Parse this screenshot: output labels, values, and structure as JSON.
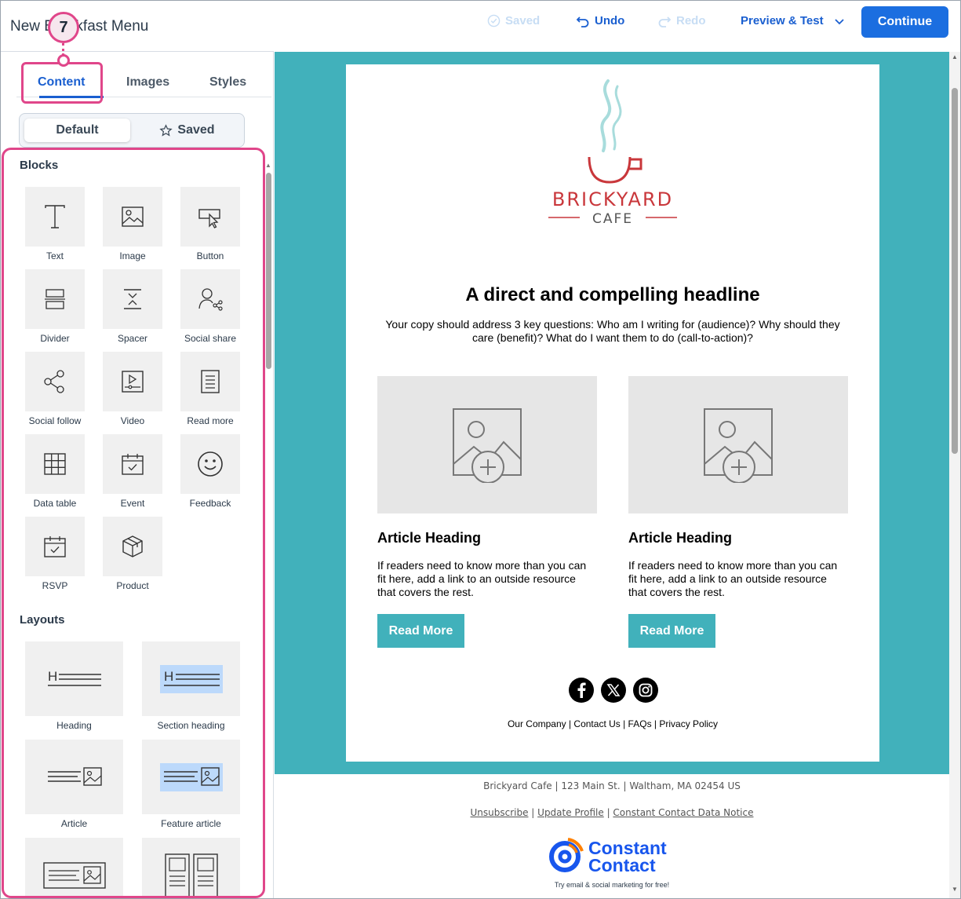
{
  "header": {
    "title": "New Breakfast Menu",
    "saved_label": "Saved",
    "undo_label": "Undo",
    "redo_label": "Redo",
    "preview_label": "Preview & Test",
    "continue_label": "Continue"
  },
  "callout": {
    "number": "7"
  },
  "tabs": [
    {
      "label": "Content"
    },
    {
      "label": "Images"
    },
    {
      "label": "Styles"
    }
  ],
  "segmented": {
    "default_label": "Default",
    "saved_label": "Saved"
  },
  "blocks": {
    "title": "Blocks",
    "items": [
      {
        "label": "Text",
        "icon": "text-icon"
      },
      {
        "label": "Image",
        "icon": "image-icon"
      },
      {
        "label": "Button",
        "icon": "button-icon"
      },
      {
        "label": "Divider",
        "icon": "divider-icon"
      },
      {
        "label": "Spacer",
        "icon": "spacer-icon"
      },
      {
        "label": "Social share",
        "icon": "social-share-icon"
      },
      {
        "label": "Social follow",
        "icon": "social-follow-icon"
      },
      {
        "label": "Video",
        "icon": "video-icon"
      },
      {
        "label": "Read more",
        "icon": "read-more-icon"
      },
      {
        "label": "Data table",
        "icon": "data-table-icon"
      },
      {
        "label": "Event",
        "icon": "event-icon"
      },
      {
        "label": "Feedback",
        "icon": "feedback-icon"
      },
      {
        "label": "RSVP",
        "icon": "rsvp-icon"
      },
      {
        "label": "Product",
        "icon": "product-icon"
      }
    ]
  },
  "layouts": {
    "title": "Layouts",
    "items": [
      {
        "label": "Heading"
      },
      {
        "label": "Section heading"
      },
      {
        "label": "Article"
      },
      {
        "label": "Feature article"
      }
    ]
  },
  "email": {
    "logo_line1": "BRICKYARD",
    "logo_line2": "CAFE",
    "headline": "A direct and compelling headline",
    "body": "Your copy should address 3 key questions: Who am I writing for (audience)? Why should they care (benefit)? What do I want them to do (call-to-action)?",
    "articles": [
      {
        "heading": "Article Heading",
        "text": "If readers need to know more than you can fit here, add a link to an outside resource that covers the rest.",
        "button": "Read More"
      },
      {
        "heading": "Article Heading",
        "text": "If readers need to know more than you can fit here, add a link to an outside resource that covers the rest.",
        "button": "Read More"
      }
    ],
    "footer_links": "Our Company | Contact Us | FAQs | Privacy Policy"
  },
  "below_email": {
    "address": "Brickyard Cafe | 123 Main St. | Waltham, MA 02454 US",
    "unsubscribe": "Unsubscribe",
    "update_profile": "Update Profile",
    "data_notice": "Constant Contact Data Notice",
    "separator": " | ",
    "cc_line1": "Constant",
    "cc_line2": "Contact",
    "cc_tagline": "Try email & social marketing for free!"
  },
  "colors": {
    "accent": "#1b6ee0",
    "canvas_bg": "#41b1bb",
    "callout": "#e0468a",
    "logo_red": "#c9373b"
  }
}
